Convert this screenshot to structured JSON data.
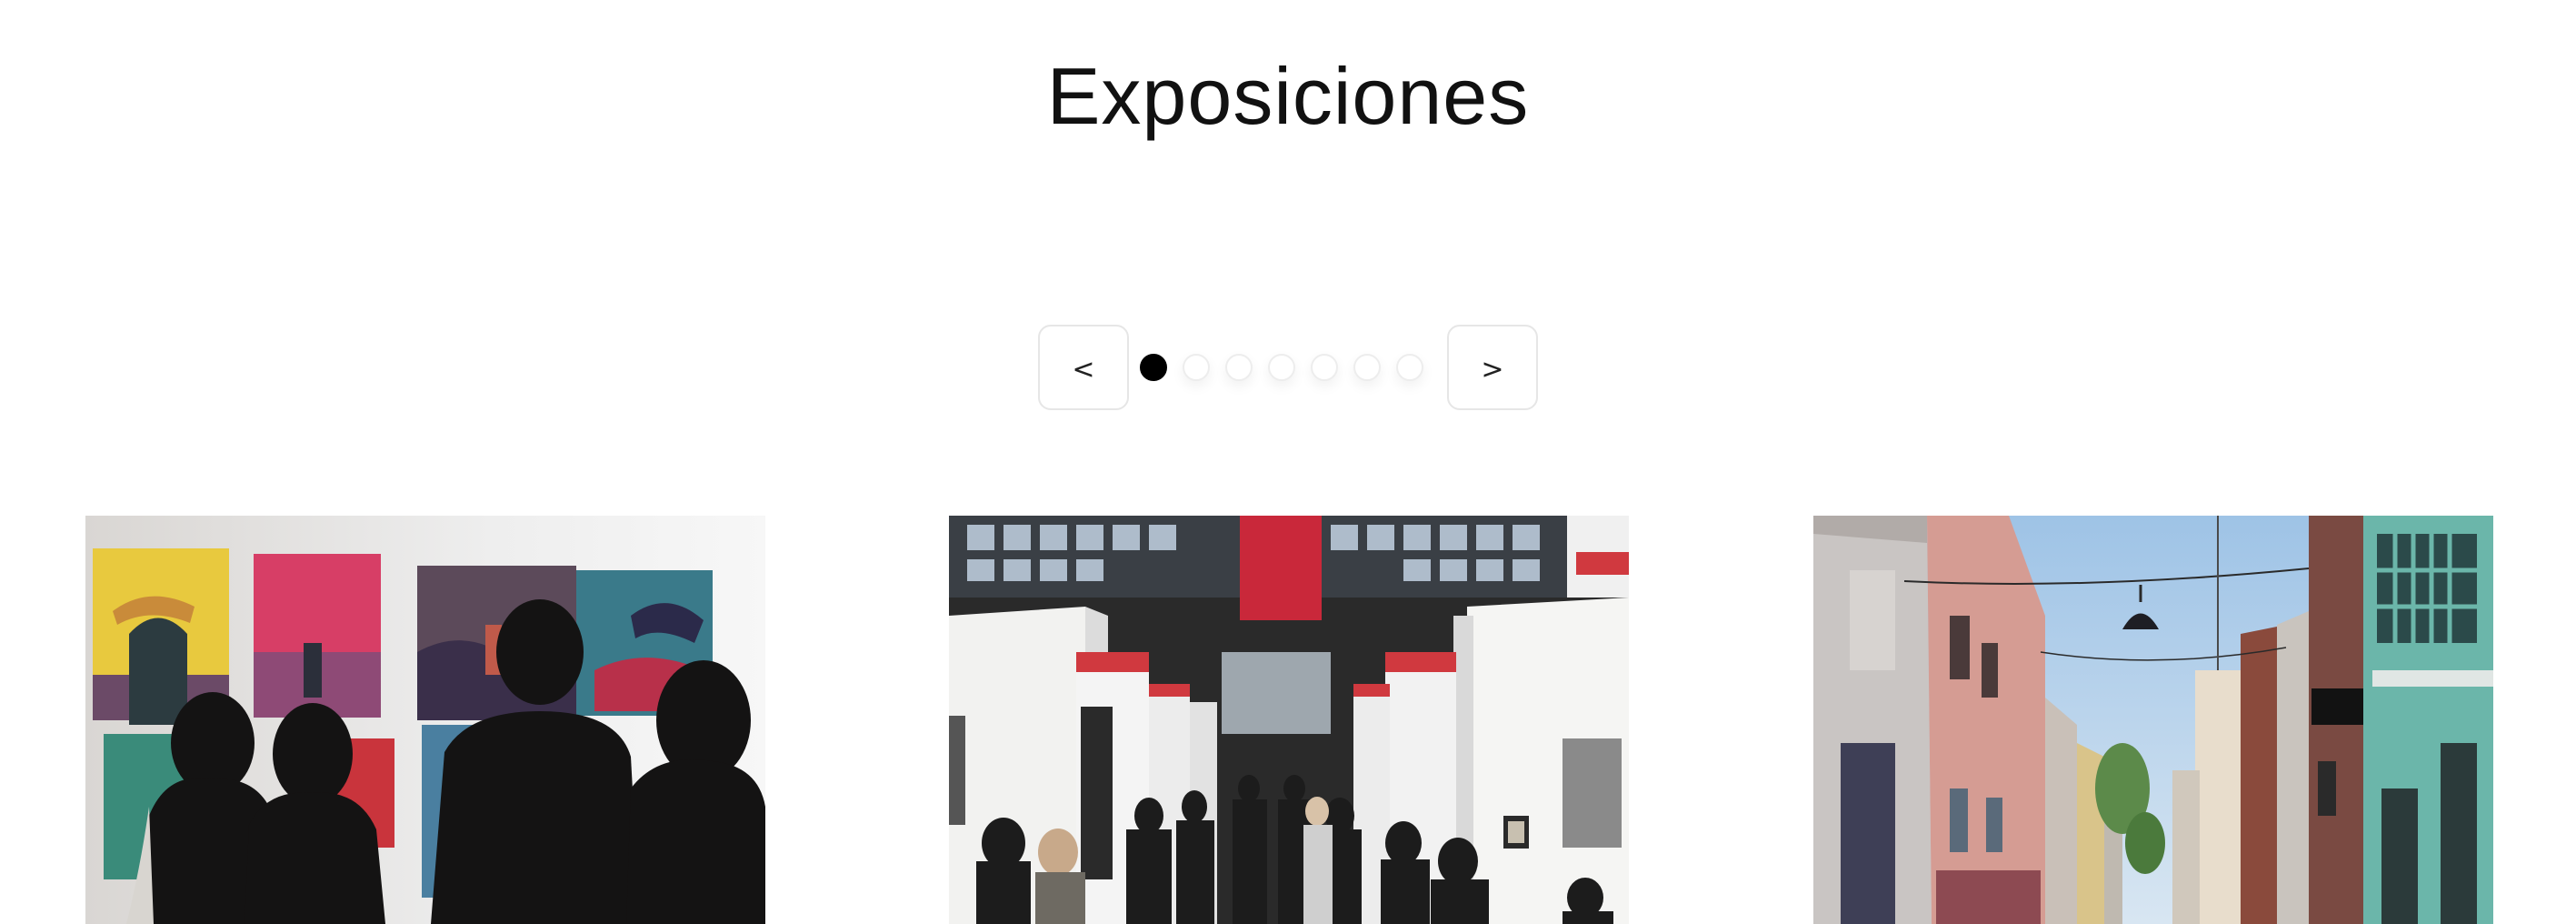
{
  "page": {
    "title": "Exposiciones"
  },
  "pager": {
    "prev_label": "<",
    "next_label": ">",
    "dot_count": 7,
    "active_index": 0
  },
  "cards": [
    {
      "image": "gallery-visitors-viewing-paintings"
    },
    {
      "image": "art-fair-crowd-in-warehouse"
    },
    {
      "image": "street-with-colorful-buildings"
    }
  ]
}
